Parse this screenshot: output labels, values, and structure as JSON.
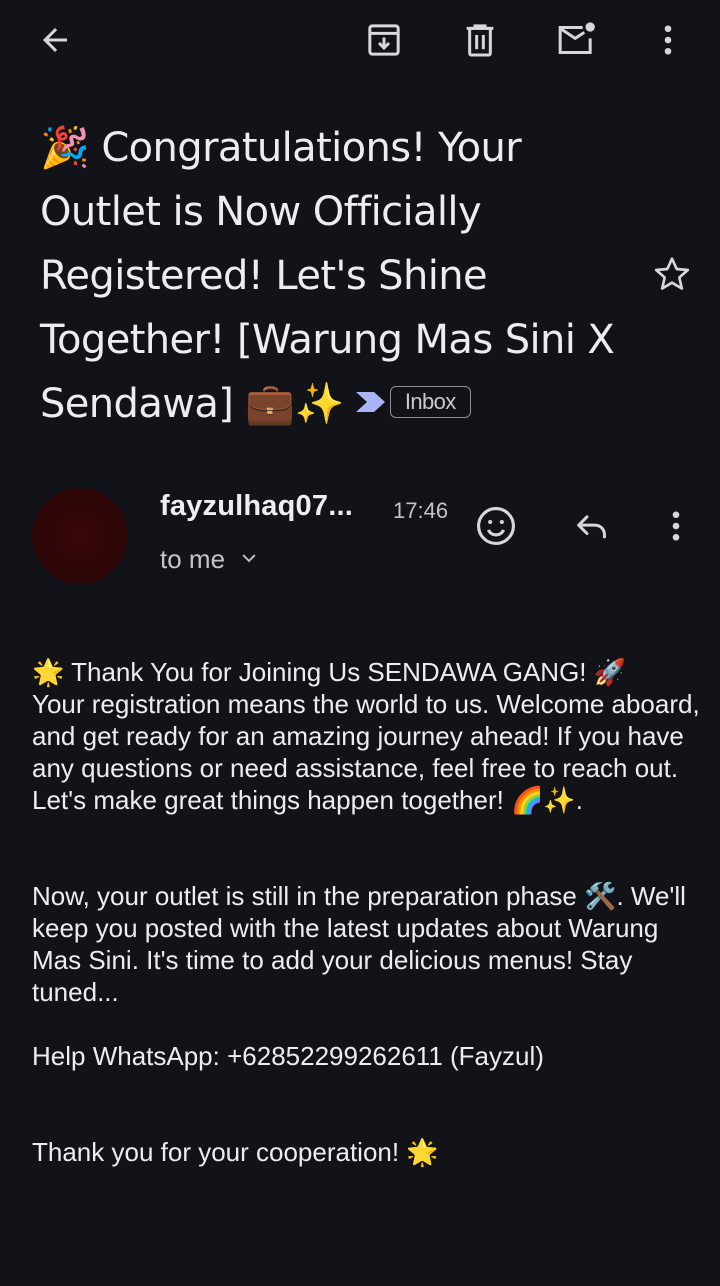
{
  "toolbar": {
    "back_icon": "arrow-left-icon",
    "archive_icon": "archive-icon",
    "delete_icon": "trash-icon",
    "mark_unread_icon": "mail-unread-icon",
    "more_icon": "more-vertical-icon"
  },
  "email": {
    "subject": "🎉 Congratulations! Your Outlet is Now Officially Registered! Let's Shine Together! [Warung Mas Sini X Sendawa] 💼✨",
    "label": "Inbox",
    "star_icon": "star-outline-icon",
    "sender": {
      "name": "fayzulhaq07...",
      "time": "17:46",
      "recipient": "to me"
    },
    "body": {
      "p1": "🌟 Thank You for Joining Us SENDAWA GANG! 🚀\nYour registration means the world to us. Welcome aboard, and get ready for an amazing journey ahead! If you have any questions or need assistance, feel free to reach out. Let's make great things happen together! 🌈✨.",
      "p2": "Now, your outlet is still in the preparation phase 🛠️. We'll keep you posted with the latest updates about Warung Mas Sini. It's time to add your delicious menus! Stay tuned...",
      "p3": "Help WhatsApp: +62852299262611 (Fayzul)",
      "p4": "Thank you for your cooperation! 🌟"
    }
  },
  "colors": {
    "background": "#121319",
    "text": "#ececf1",
    "secondary_text": "#c4c4ca",
    "importance_marker": "#a8b4f4",
    "avatar": "#2c0608"
  }
}
